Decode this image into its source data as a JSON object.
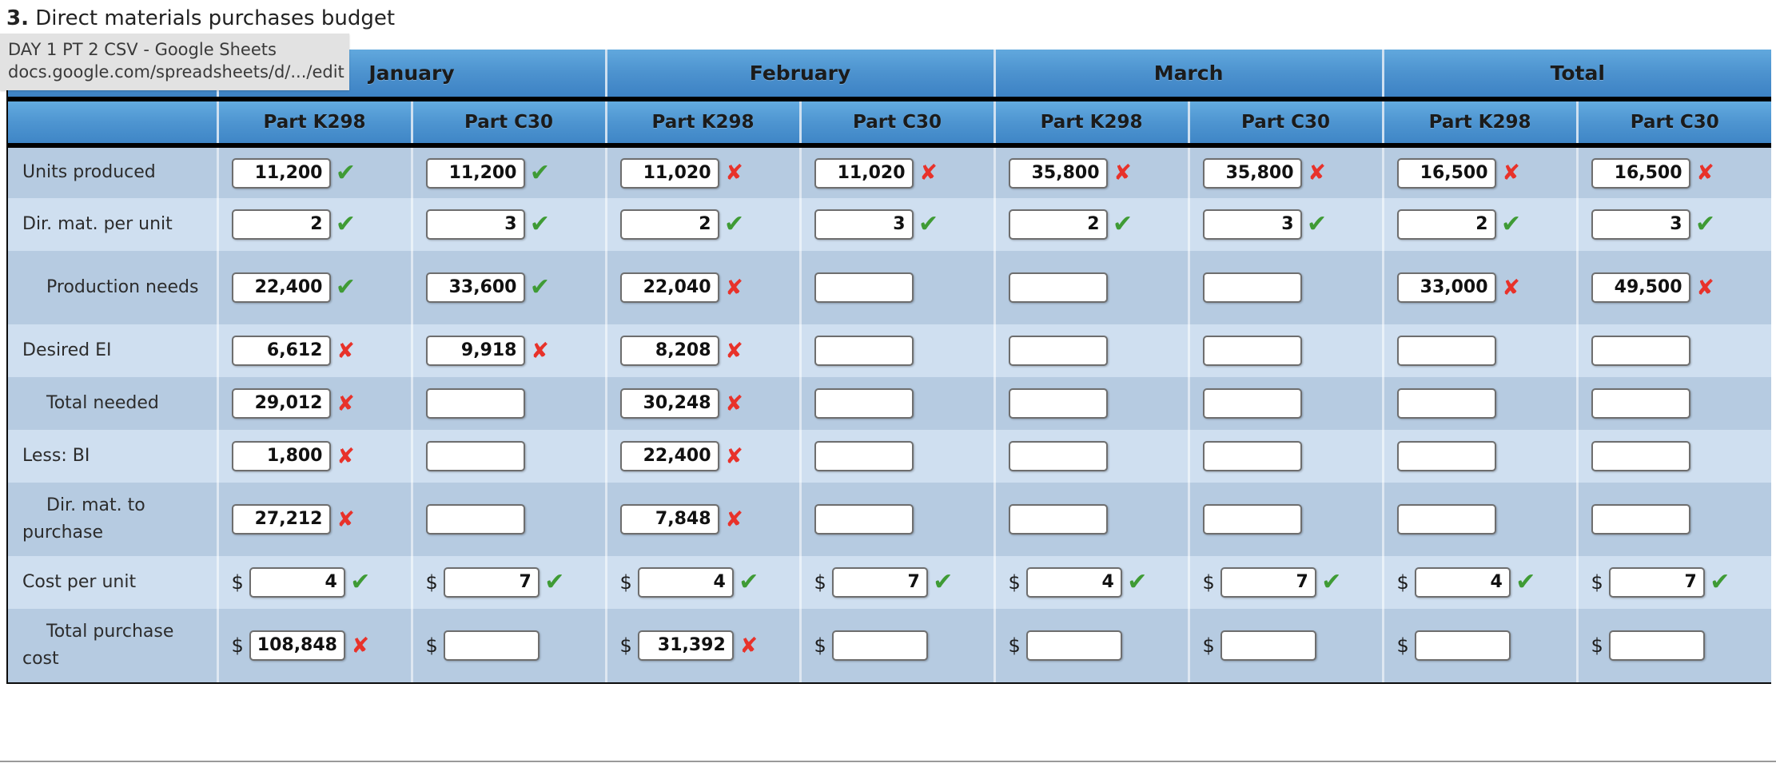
{
  "title": {
    "number": "3.",
    "text": "Direct materials purchases budget"
  },
  "status_tooltip": {
    "line1": "DAY 1 PT 2 CSV - Google Sheets",
    "line2": "docs.google.com/spreadsheets/d/.../edit"
  },
  "colors": {
    "header_blue": "#4d93cf",
    "row_dark": "#b6cbe1",
    "row_light": "#cfdff0",
    "check_green": "#3f9b35",
    "cross_red": "#e8322a"
  },
  "table": {
    "corner_label": "",
    "months": [
      "January",
      "February",
      "March",
      "Total"
    ],
    "parts": [
      "Part K298",
      "Part C30"
    ],
    "column_headers": [
      "Part K298",
      "Part C30",
      "Part K298",
      "Part C30",
      "Part K298",
      "Part C30",
      "Part K298",
      "Part C30"
    ],
    "rows": [
      {
        "label": "Units produced",
        "indent": false,
        "tall": false,
        "currency": false,
        "cells": [
          {
            "value": "11,200",
            "mark": "check"
          },
          {
            "value": "11,200",
            "mark": "check"
          },
          {
            "value": "11,020",
            "mark": "cross"
          },
          {
            "value": "11,020",
            "mark": "cross"
          },
          {
            "value": "35,800",
            "mark": "cross"
          },
          {
            "value": "35,800",
            "mark": "cross"
          },
          {
            "value": "16,500",
            "mark": "cross"
          },
          {
            "value": "16,500",
            "mark": "cross"
          }
        ]
      },
      {
        "label": "Dir. mat. per unit",
        "indent": false,
        "tall": false,
        "currency": false,
        "cells": [
          {
            "value": "2",
            "mark": "check"
          },
          {
            "value": "3",
            "mark": "check"
          },
          {
            "value": "2",
            "mark": "check"
          },
          {
            "value": "3",
            "mark": "check"
          },
          {
            "value": "2",
            "mark": "check"
          },
          {
            "value": "3",
            "mark": "check"
          },
          {
            "value": "2",
            "mark": "check"
          },
          {
            "value": "3",
            "mark": "check"
          }
        ]
      },
      {
        "label": "Production needs",
        "indent": true,
        "tall": true,
        "currency": false,
        "cells": [
          {
            "value": "22,400",
            "mark": "check"
          },
          {
            "value": "33,600",
            "mark": "check"
          },
          {
            "value": "22,040",
            "mark": "cross"
          },
          {
            "value": "",
            "mark": "none"
          },
          {
            "value": "",
            "mark": "none"
          },
          {
            "value": "",
            "mark": "none"
          },
          {
            "value": "33,000",
            "mark": "cross"
          },
          {
            "value": "49,500",
            "mark": "cross"
          }
        ]
      },
      {
        "label": "Desired EI",
        "indent": false,
        "tall": false,
        "currency": false,
        "cells": [
          {
            "value": "6,612",
            "mark": "cross"
          },
          {
            "value": "9,918",
            "mark": "cross"
          },
          {
            "value": "8,208",
            "mark": "cross"
          },
          {
            "value": "",
            "mark": "none"
          },
          {
            "value": "",
            "mark": "none"
          },
          {
            "value": "",
            "mark": "none"
          },
          {
            "value": "",
            "mark": "none"
          },
          {
            "value": "",
            "mark": "none"
          }
        ]
      },
      {
        "label": "Total needed",
        "indent": true,
        "tall": false,
        "currency": false,
        "cells": [
          {
            "value": "29,012",
            "mark": "cross"
          },
          {
            "value": "",
            "mark": "none"
          },
          {
            "value": "30,248",
            "mark": "cross"
          },
          {
            "value": "",
            "mark": "none"
          },
          {
            "value": "",
            "mark": "none"
          },
          {
            "value": "",
            "mark": "none"
          },
          {
            "value": "",
            "mark": "none"
          },
          {
            "value": "",
            "mark": "none"
          }
        ]
      },
      {
        "label": "Less: BI",
        "indent": false,
        "tall": false,
        "currency": false,
        "cells": [
          {
            "value": "1,800",
            "mark": "cross"
          },
          {
            "value": "",
            "mark": "none"
          },
          {
            "value": "22,400",
            "mark": "cross"
          },
          {
            "value": "",
            "mark": "none"
          },
          {
            "value": "",
            "mark": "none"
          },
          {
            "value": "",
            "mark": "none"
          },
          {
            "value": "",
            "mark": "none"
          },
          {
            "value": "",
            "mark": "none"
          }
        ]
      },
      {
        "label": "Dir. mat. to purchase",
        "indent": true,
        "tall": true,
        "currency": false,
        "cells": [
          {
            "value": "27,212",
            "mark": "cross"
          },
          {
            "value": "",
            "mark": "none"
          },
          {
            "value": "7,848",
            "mark": "cross"
          },
          {
            "value": "",
            "mark": "none"
          },
          {
            "value": "",
            "mark": "none"
          },
          {
            "value": "",
            "mark": "none"
          },
          {
            "value": "",
            "mark": "none"
          },
          {
            "value": "",
            "mark": "none"
          }
        ]
      },
      {
        "label": "Cost per unit",
        "indent": false,
        "tall": false,
        "currency": true,
        "cells": [
          {
            "value": "4",
            "mark": "check"
          },
          {
            "value": "7",
            "mark": "check"
          },
          {
            "value": "4",
            "mark": "check"
          },
          {
            "value": "7",
            "mark": "check"
          },
          {
            "value": "4",
            "mark": "check"
          },
          {
            "value": "7",
            "mark": "check"
          },
          {
            "value": "4",
            "mark": "check"
          },
          {
            "value": "7",
            "mark": "check"
          }
        ]
      },
      {
        "label": "Total purchase cost",
        "indent": true,
        "tall": true,
        "currency": true,
        "cells": [
          {
            "value": "108,848",
            "mark": "cross"
          },
          {
            "value": "",
            "mark": "none"
          },
          {
            "value": "31,392",
            "mark": "cross"
          },
          {
            "value": "",
            "mark": "none"
          },
          {
            "value": "",
            "mark": "none"
          },
          {
            "value": "",
            "mark": "none"
          },
          {
            "value": "",
            "mark": "none"
          },
          {
            "value": "",
            "mark": "none"
          }
        ]
      }
    ],
    "currency_symbol": "$",
    "marks": {
      "check": "✔",
      "cross": "✘"
    }
  }
}
